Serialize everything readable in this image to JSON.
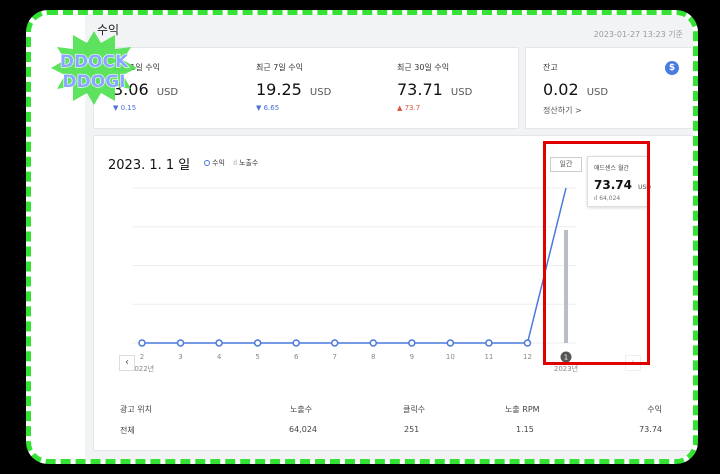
{
  "header": {
    "title": "수익",
    "updated": "2023-01-27 13:23 기준"
  },
  "stats": [
    {
      "label": "최근 1일 수익",
      "value": "3.06",
      "unit": "USD",
      "delta": "▼ 0.15",
      "direction": "down"
    },
    {
      "label": "최근 7일 수익",
      "value": "19.25",
      "unit": "USD",
      "delta": "▼ 6.65",
      "direction": "down"
    },
    {
      "label": "최근 30일 수익",
      "value": "73.71",
      "unit": "USD",
      "delta": "▲ 73.7",
      "direction": "up"
    }
  ],
  "balance": {
    "label": "잔고",
    "value": "0.02",
    "unit": "USD",
    "link": "정산하기 >",
    "icon": "dollar-icon",
    "icon_glyph": "$"
  },
  "chart": {
    "title": "2023. 1. 1 일",
    "legend_revenue": "수익",
    "legend_impressions": "노출수",
    "period_button": "일간",
    "tooltip_label": "애드센스 월간",
    "tooltip_value": "73.74",
    "tooltip_unit": "USD",
    "tooltip_impressions": "ıl 64,024",
    "prev_icon": "‹",
    "next_icon": "›"
  },
  "chart_data": {
    "type": "line",
    "categories": [
      "2",
      "3",
      "4",
      "5",
      "6",
      "7",
      "8",
      "9",
      "10",
      "11",
      "12",
      "1"
    ],
    "year_labels": [
      {
        "index": 0,
        "text": "2022년"
      },
      {
        "index": 11,
        "text": "2023년"
      }
    ],
    "series": [
      {
        "name": "수익",
        "type": "line",
        "values": [
          0,
          0,
          0,
          0,
          0,
          0,
          0,
          0,
          0,
          0,
          0,
          73.74
        ]
      },
      {
        "name": "노출수",
        "type": "bar",
        "values": [
          0,
          0,
          0,
          0,
          0,
          0,
          0,
          0,
          0,
          0,
          0,
          64024
        ]
      }
    ],
    "selected_index": 11,
    "colors": {
      "line": "#4a78dc",
      "bar": "#b9bec6",
      "grid": "#eeeeee"
    }
  },
  "table": {
    "headers": [
      "광고 위치",
      "노출수",
      "클릭수",
      "노출 RPM",
      "수익"
    ],
    "rows": [
      [
        "전체",
        "64,024",
        "251",
        "1.15",
        "73.74"
      ]
    ]
  },
  "sticker": {
    "line1": "DDOCK",
    "line2": "DDOGI"
  },
  "colors": {
    "frame": "#33e233",
    "highlight": "#e10000",
    "accent": "#4a78dc"
  }
}
